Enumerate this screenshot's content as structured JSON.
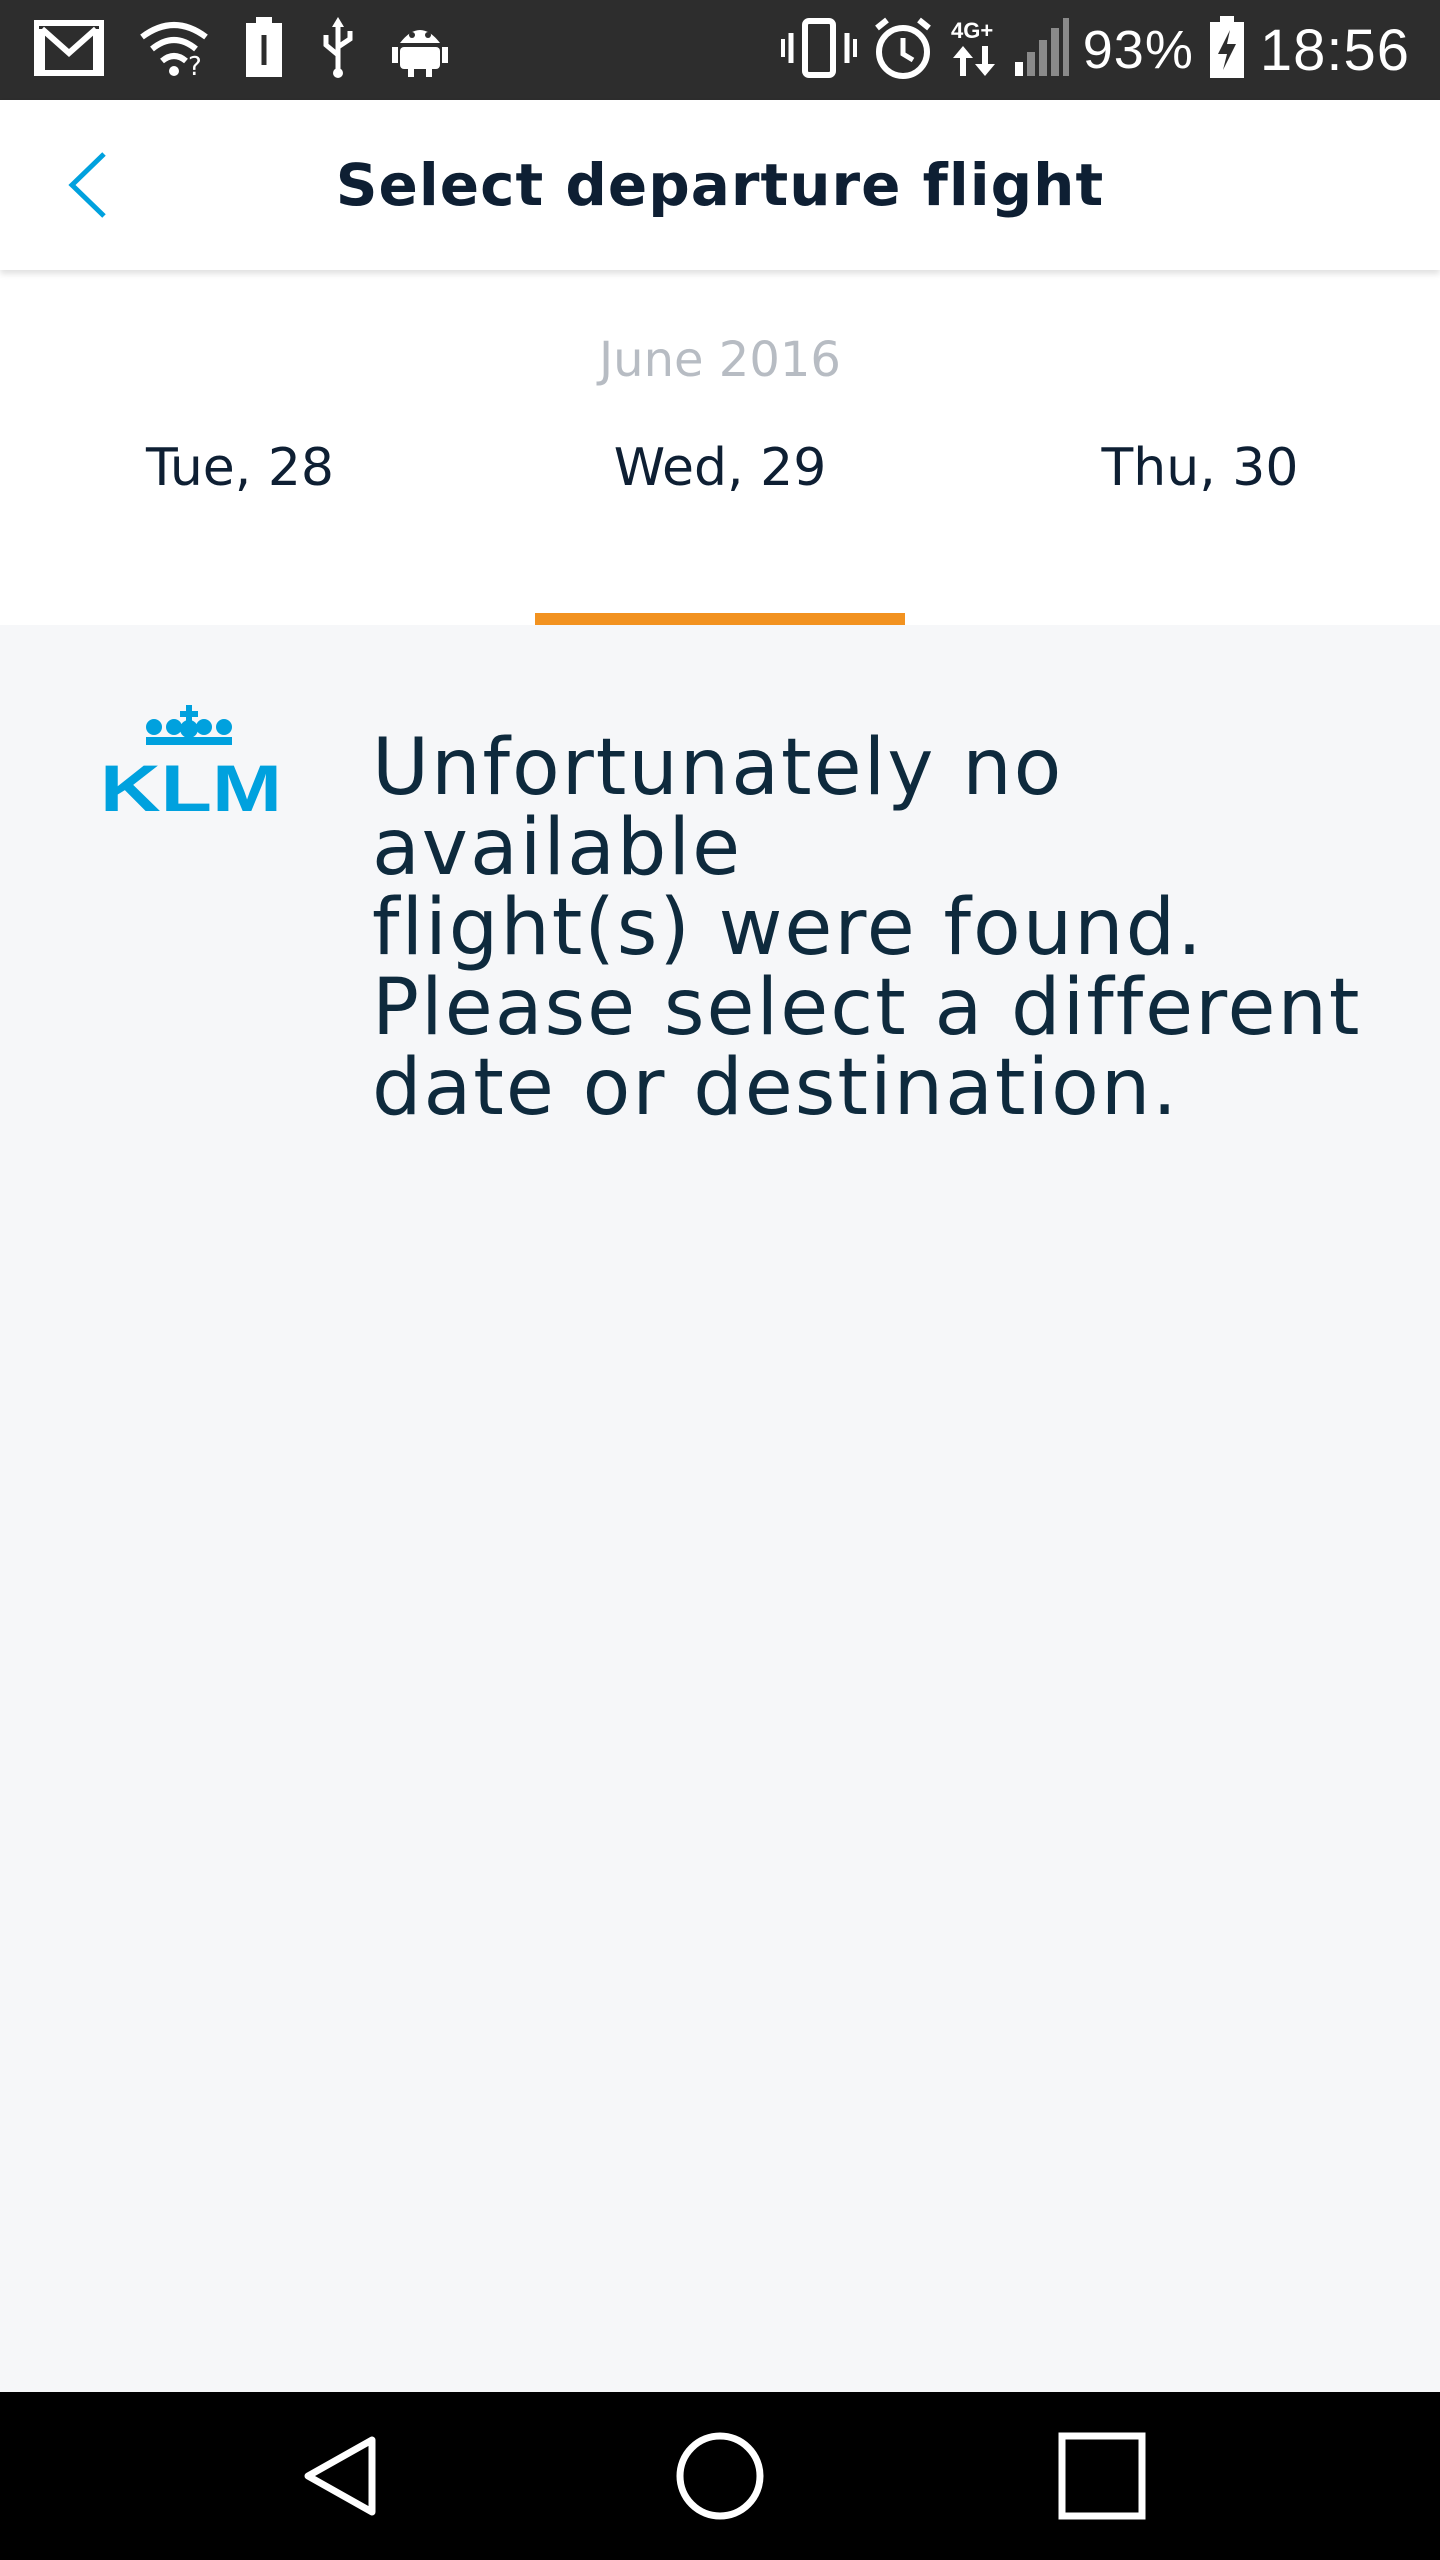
{
  "status_bar": {
    "battery_percent": "93%",
    "time": "18:56",
    "network_label": "4G+",
    "left_icons": [
      "gmail-icon",
      "wifi-question-icon",
      "battery-saver-icon",
      "usb-icon",
      "android-debug-icon"
    ],
    "right_icons": [
      "vibrate-icon",
      "alarm-icon",
      "network-4g-icon",
      "signal-icon",
      "battery-charging-icon"
    ]
  },
  "app_bar": {
    "title": "Select departure flight",
    "back_icon": "chevron-left-icon"
  },
  "date_selector": {
    "month": "June 2016",
    "tabs": [
      {
        "label": "Tue, 28"
      },
      {
        "label": "Wed, 29",
        "selected": true
      },
      {
        "label": "Thu, 30"
      }
    ],
    "indicator_color": "#f29220"
  },
  "content": {
    "logo_text": "KLM",
    "message_lines": [
      "Unfortunately no available",
      "flight(s) were found.",
      "Please select a different",
      "date or destination."
    ]
  },
  "colors": {
    "accent": "#00a1de",
    "title_text": "#0e1f33",
    "page_background": "#f6f7f9"
  },
  "nav_bar": {
    "icons": [
      "nav-back-icon",
      "nav-home-icon",
      "nav-recents-icon"
    ]
  }
}
